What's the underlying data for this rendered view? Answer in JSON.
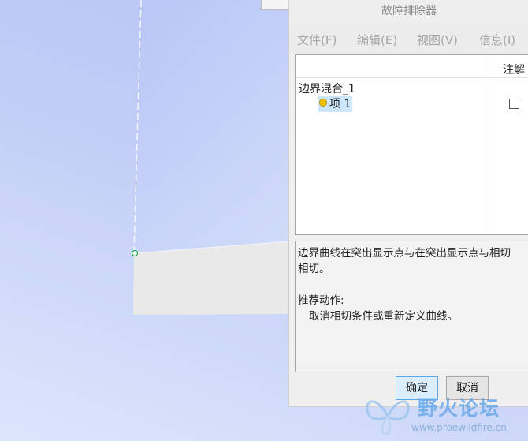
{
  "dialog": {
    "title": "故障排除器",
    "menu": [
      "文件(F)",
      "编辑(E)",
      "视图(V)",
      "信息(I)"
    ],
    "tree": {
      "column_annotation": "注解",
      "root": "边界混合_1",
      "child": "项 1",
      "child_status_icon": "warning-dot",
      "annotation_checked": false
    },
    "message": {
      "line1": "边界曲线在突出显示点与在突出显示点与相切",
      "line2": "相切。",
      "blank": "",
      "recommend_label": "推荐动作:",
      "recommend_action": "取消相切条件或重新定义曲线。"
    },
    "ok_label": "确定",
    "cancel_label": "取消"
  },
  "watermark": {
    "title": "野火论坛",
    "url": "www.proewildfire.cn"
  },
  "colors": {
    "viewport_top": "#b4c2f6",
    "viewport_bottom": "#dbe6fc",
    "surface": "#e9e9ea",
    "selection": "#cce6fb",
    "ok_border": "#5fa3dd",
    "highlight_point": "#27a84a"
  }
}
